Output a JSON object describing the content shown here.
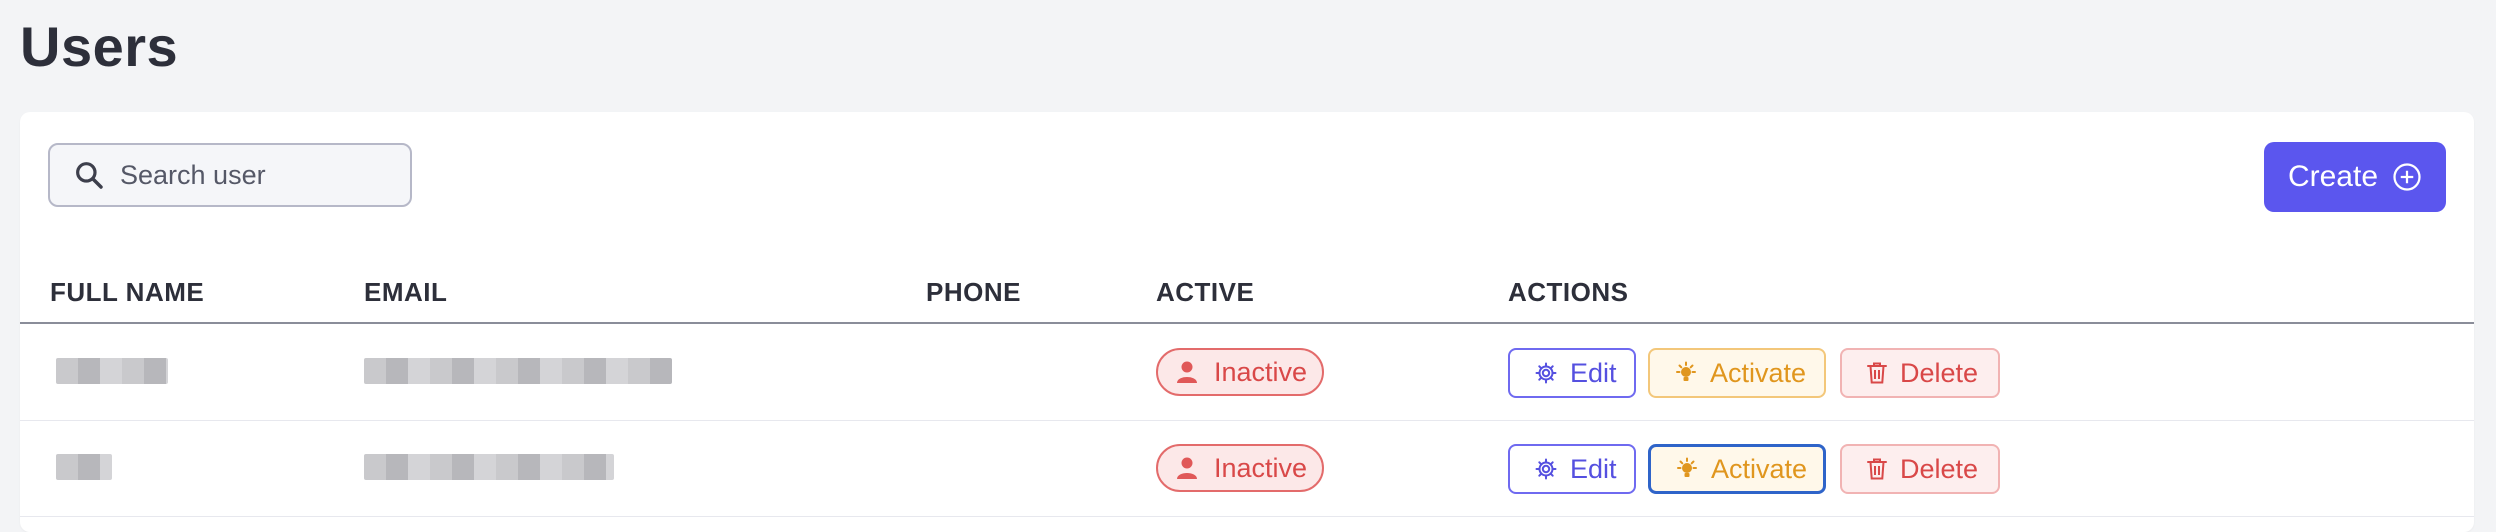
{
  "page": {
    "title": "Users"
  },
  "search": {
    "placeholder": "Search user",
    "value": ""
  },
  "toolbar": {
    "create_label": "Create"
  },
  "table": {
    "columns": [
      "FULL NAME",
      "EMAIL",
      "PHONE",
      "ACTIVE",
      "ACTIONS"
    ],
    "rows": [
      {
        "status": "Inactive",
        "actions": {
          "edit": "Edit",
          "activate": "Activate",
          "delete": "Delete"
        }
      },
      {
        "status": "Inactive",
        "actions": {
          "edit": "Edit",
          "activate": "Activate",
          "delete": "Delete"
        }
      }
    ]
  },
  "icons": {
    "search": "search-icon",
    "create": "plus-circle-icon",
    "inactive": "user-icon",
    "edit": "gear-icon",
    "activate": "lightbulb-icon",
    "delete": "trash-icon"
  },
  "colors": {
    "primary": "#5b56ee",
    "inactive": "#d94848",
    "activate": "#e0961e",
    "edit": "#5550e0"
  }
}
